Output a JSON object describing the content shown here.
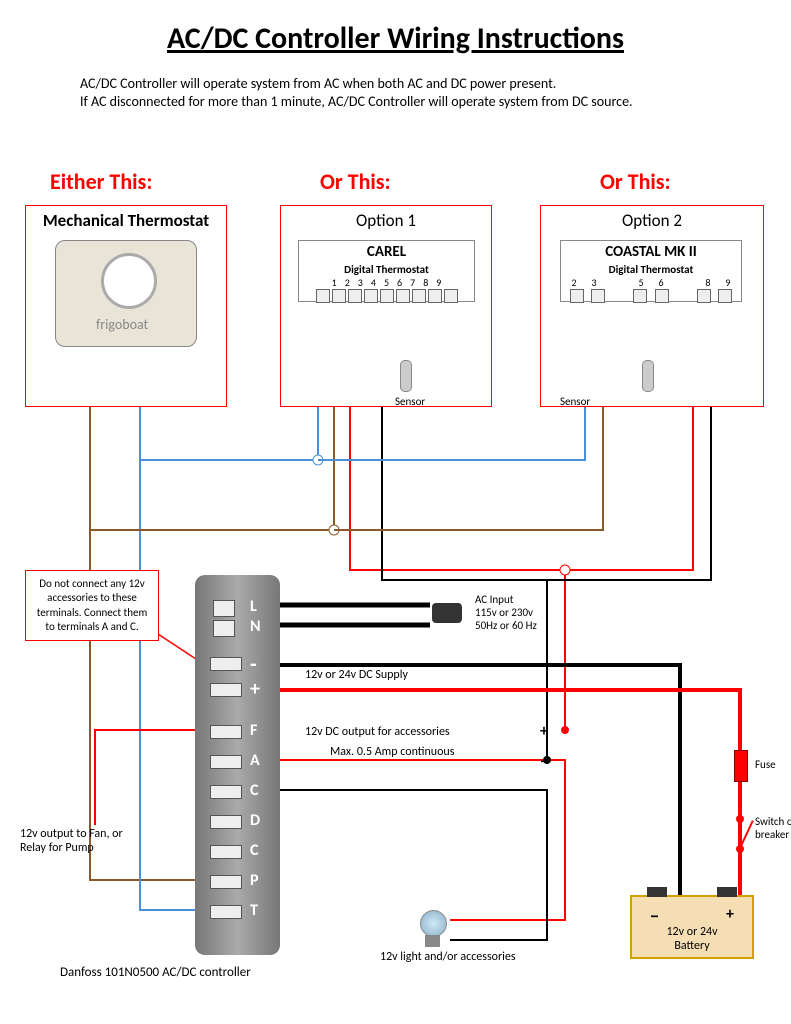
{
  "title": "AC/DC Controller  Wiring Instructions",
  "intro_line1": "AC/DC Controller will operate system from AC when both AC and DC power present.",
  "intro_line2": "If AC disconnected for more than 1 minute, AC/DC Controller will operate system from DC source.",
  "headings": {
    "either": "Either This:",
    "or1": "Or This:",
    "or2": "Or This:"
  },
  "mechanical": {
    "title": "Mechanical Thermostat",
    "brand": "frigoboat"
  },
  "option1": {
    "title": "Option 1",
    "brand": "CAREL",
    "sub": "Digital Thermostat",
    "terms": [
      "1",
      "2",
      "3",
      "4",
      "5",
      "6",
      "7",
      "8",
      "9"
    ],
    "sensor": "Sensor"
  },
  "option2": {
    "title": "Option 2",
    "brand": "COASTAL MK II",
    "sub": "Digital Thermostat",
    "terms": [
      "2",
      "3",
      "",
      "5",
      "6",
      "",
      "8",
      "9"
    ],
    "sensor": "Sensor"
  },
  "note": "Do not connect any 12v accessories to these terminals. Connect them to terminals A and C.",
  "controller": {
    "labels": [
      "L",
      "N",
      "-",
      "+",
      "F",
      "A",
      "C",
      "D",
      "C",
      "P",
      "T"
    ],
    "caption": "Danfoss 101N0500 AC/DC controller"
  },
  "labels": {
    "ac_input": "AC Input\n115v or 230v\n50Hz or 60 Hz",
    "dc_supply": "12v or 24v DC Supply",
    "dc_out1": "12v DC output for accessories",
    "dc_out2": "Max. 0.5 Amp continuous",
    "fan": "12v output to Fan, or Relay for Pump",
    "light": "12v light and/or accessories",
    "battery": "12v or 24v\nBattery",
    "fuse": "Fuse",
    "switch": "Switch or breaker",
    "plus": "+",
    "minus": "−"
  }
}
